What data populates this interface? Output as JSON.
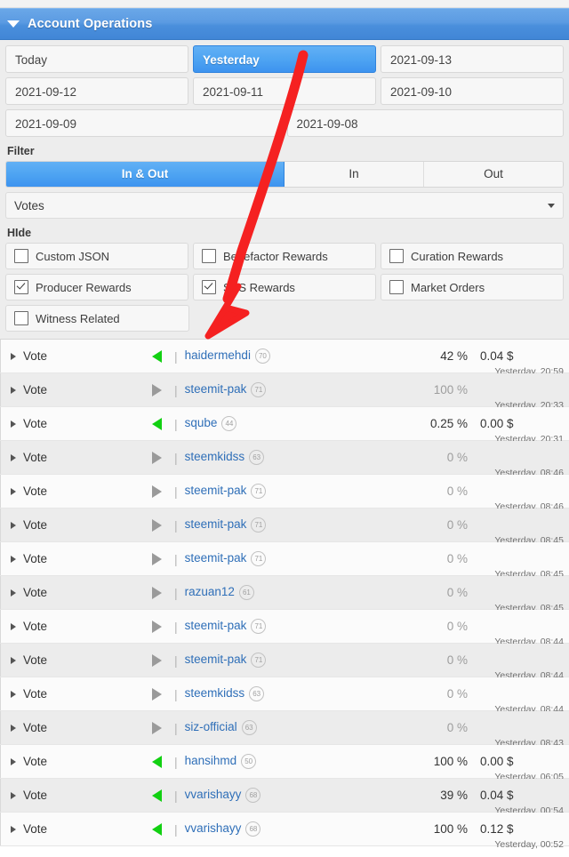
{
  "panel": {
    "title": "Account Operations",
    "collapse_icon": "triangle-down-icon"
  },
  "date_tabs": {
    "rows": [
      [
        {
          "label": "Today",
          "selected": false
        },
        {
          "label": "Yesterday",
          "selected": true
        },
        {
          "label": "2021-09-13",
          "selected": false
        }
      ],
      [
        {
          "label": "2021-09-12",
          "selected": false
        },
        {
          "label": "2021-09-11",
          "selected": false
        },
        {
          "label": "2021-09-10",
          "selected": false
        }
      ],
      [
        {
          "label": "2021-09-09",
          "selected": false
        },
        {
          "label": "2021-09-08",
          "selected": false
        }
      ]
    ]
  },
  "filter": {
    "label": "Filter",
    "segments": [
      {
        "label": "In & Out",
        "active": true
      },
      {
        "label": "In",
        "active": false
      },
      {
        "label": "Out",
        "active": false
      }
    ],
    "type_select": {
      "value": "Votes",
      "caret_icon": "caret-down-icon"
    }
  },
  "hide": {
    "label": "HIde",
    "rows": [
      [
        {
          "label": "Custom JSON",
          "checked": false
        },
        {
          "label": "Benefactor Rewards",
          "checked": false
        },
        {
          "label": "Curation Rewards",
          "checked": false
        }
      ],
      [
        {
          "label": "Producer Rewards",
          "checked": true
        },
        {
          "label": "SPS Rewards",
          "checked": true
        },
        {
          "label": "Market Orders",
          "checked": false
        }
      ],
      [
        {
          "label": "Witness Related",
          "checked": false
        }
      ]
    ]
  },
  "operations": {
    "rows": [
      {
        "type": "Vote",
        "direction": "in",
        "account": "haidermehdi",
        "reputation": "70",
        "percent": "42 %",
        "amount": "0.04 $",
        "timestamp": "Yesterday, 20:59"
      },
      {
        "type": "Vote",
        "direction": "out",
        "account": "steemit-pak",
        "reputation": "71",
        "percent": "100 %",
        "amount": "",
        "timestamp": "Yesterday, 20:33"
      },
      {
        "type": "Vote",
        "direction": "in",
        "account": "sqube",
        "reputation": "44",
        "percent": "0.25 %",
        "amount": "0.00 $",
        "timestamp": "Yesterday, 20:31"
      },
      {
        "type": "Vote",
        "direction": "out",
        "account": "steemkidss",
        "reputation": "63",
        "percent": "0 %",
        "amount": "",
        "timestamp": "Yesterday, 08:46"
      },
      {
        "type": "Vote",
        "direction": "out",
        "account": "steemit-pak",
        "reputation": "71",
        "percent": "0 %",
        "amount": "",
        "timestamp": "Yesterday, 08:46"
      },
      {
        "type": "Vote",
        "direction": "out",
        "account": "steemit-pak",
        "reputation": "71",
        "percent": "0 %",
        "amount": "",
        "timestamp": "Yesterday, 08:45"
      },
      {
        "type": "Vote",
        "direction": "out",
        "account": "steemit-pak",
        "reputation": "71",
        "percent": "0 %",
        "amount": "",
        "timestamp": "Yesterday, 08:45"
      },
      {
        "type": "Vote",
        "direction": "out",
        "account": "razuan12",
        "reputation": "61",
        "percent": "0 %",
        "amount": "",
        "timestamp": "Yesterday, 08:45"
      },
      {
        "type": "Vote",
        "direction": "out",
        "account": "steemit-pak",
        "reputation": "71",
        "percent": "0 %",
        "amount": "",
        "timestamp": "Yesterday, 08:44"
      },
      {
        "type": "Vote",
        "direction": "out",
        "account": "steemit-pak",
        "reputation": "71",
        "percent": "0 %",
        "amount": "",
        "timestamp": "Yesterday, 08:44"
      },
      {
        "type": "Vote",
        "direction": "out",
        "account": "steemkidss",
        "reputation": "63",
        "percent": "0 %",
        "amount": "",
        "timestamp": "Yesterday, 08:44"
      },
      {
        "type": "Vote",
        "direction": "out",
        "account": "siz-official",
        "reputation": "63",
        "percent": "0 %",
        "amount": "",
        "timestamp": "Yesterday, 08:43"
      },
      {
        "type": "Vote",
        "direction": "in",
        "account": "hansihmd",
        "reputation": "50",
        "percent": "100 %",
        "amount": "0.00 $",
        "timestamp": "Yesterday, 06:05"
      },
      {
        "type": "Vote",
        "direction": "in",
        "account": "vvarishayy",
        "reputation": "68",
        "percent": "39 %",
        "amount": "0.04 $",
        "timestamp": "Yesterday, 00:54"
      },
      {
        "type": "Vote",
        "direction": "in",
        "account": "vvarishayy",
        "reputation": "68",
        "percent": "100 %",
        "amount": "0.12 $",
        "timestamp": "Yesterday, 00:52"
      }
    ]
  },
  "annotation": {
    "arrow_color": "#f52121",
    "shape": "curved-arrow-pointing-down-left"
  },
  "colors": {
    "accent_blue": "#4ea4f2",
    "header_blue": "#5b9be2",
    "link_blue": "#2f6fb8",
    "incoming_green": "#12d012",
    "outgoing_grey": "#9a9a9a",
    "panel_grey": "#ededed"
  }
}
